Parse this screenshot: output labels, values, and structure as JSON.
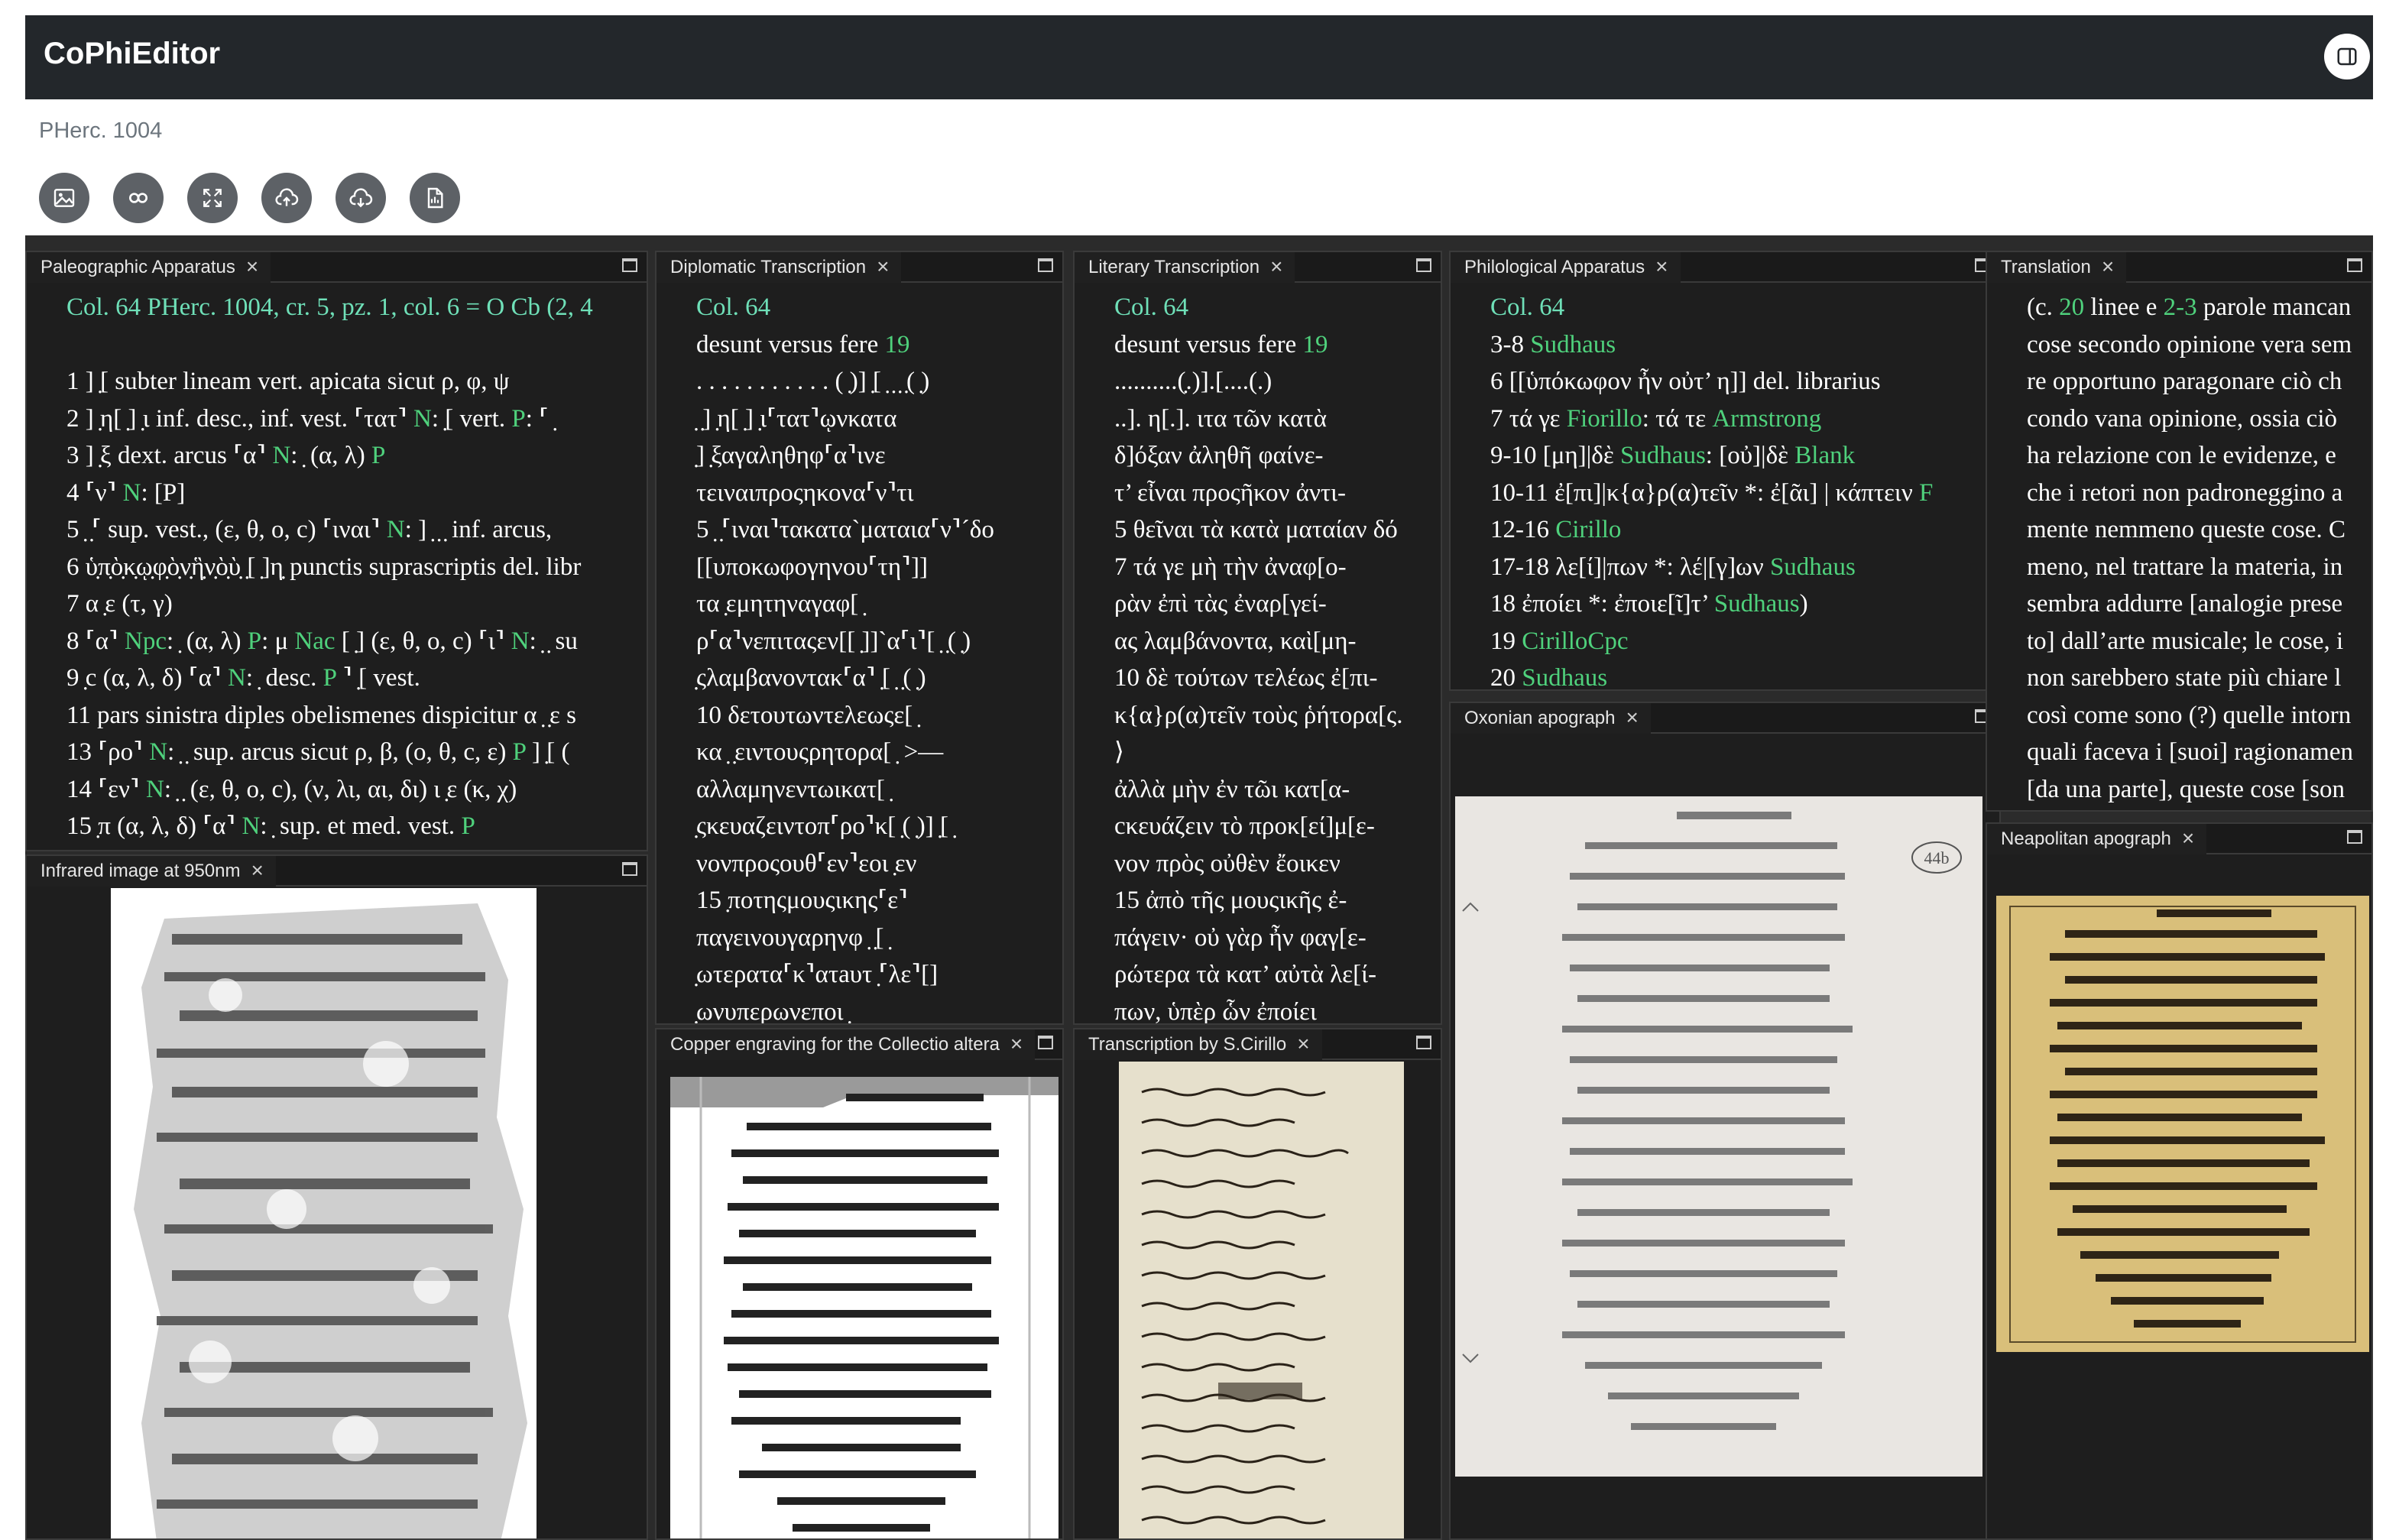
{
  "app": {
    "title": "CoPhiEditor"
  },
  "document": {
    "title": "PHerc. 1004"
  },
  "toolbar": {
    "buttons": [
      {
        "name": "image-icon"
      },
      {
        "name": "link-icon"
      },
      {
        "name": "fullscreen-icon"
      },
      {
        "name": "cloud-upload-icon"
      },
      {
        "name": "cloud-download-icon"
      },
      {
        "name": "document-icon"
      }
    ]
  },
  "colors": {
    "topbar": "#23272b",
    "panel_bg": "#1e1e1e",
    "teal_text": "#6fe0b8",
    "green_text": "#4fd17c"
  },
  "panels": {
    "paleographic": {
      "tab": "Paleographic Apparatus",
      "header": {
        "col": "Col. 64",
        "pherc": "PHerc.",
        "num": "1004, cr.",
        "cr": "5",
        "pz_label": ", pz.",
        "pz": "1",
        "col_label": ", col.",
        "col_num": "6",
        "eq": "=",
        "o": "O",
        "cb": "Cb",
        "rest": "(2, 4"
      },
      "lines": [
        [
          "1 ] ̣[ subter lineam vert. apicata sicut ρ, φ, ψ"
        ],
        [
          "2 ] ̣η[ ̣] ̣ι inf. desc., inf. vest. ⸢τατ⸣ ",
          "N",
          ": ̣[ vert. ",
          "P",
          ": ⸢ ̣"
        ],
        [
          "3 ] ̣ξ dext. arcus ⸢α⸣ ",
          "N",
          ": ̣ (α, λ) ",
          "P",
          ""
        ],
        [
          "4 ⸢ν⸣ ",
          "N",
          ": [P]",
          "",
          ""
        ],
        [
          "5 ̣ ̣⸢ sup. vest., (ε, θ, ο, c) ⸢ιναι⸣ ",
          "N",
          ": ] ̣ ̣ ̣ inf. arcus,",
          "",
          ""
        ],
        [
          "6 ὑ̣π̣ὸ̣κ̣ῳ̣φ̣ὸ̣ν̣ἣ̣ν̣ὸ̣ὺ̣ ̣[ ̣]η̣ punctis suprascriptis del. libr",
          "",
          "",
          "",
          ""
        ],
        [
          "7 α ̣ε (τ, γ)",
          "",
          "",
          "",
          ""
        ],
        [
          "8 ⸢α⸣ ",
          "Npc",
          ": ̣ (α, λ) ",
          "P",
          ": μ ",
          "Nac",
          " [ ̣] (ε, θ, ο, c) ⸢ι⸣ ",
          "N",
          ": ̣ ̣ su"
        ],
        [
          "9 ̣c (α, λ, δ) ⸢α⸣ ",
          "N",
          ": ̣ desc. ",
          "P",
          " ⸣ ̣[ vest."
        ],
        [
          "11 pars sinistra diples obelismenes dispicitur α ̣ ̣ε s",
          "",
          "",
          "",
          ""
        ],
        [
          "13 ⸢ρο⸣ ",
          "N",
          ": ̣ ̣ sup. arcus sicut ρ, β, (ο, θ, c, ε) ",
          "P",
          " ] ̣[ ("
        ],
        [
          "14 ⸢εν⸣ ",
          "N",
          ": ̣ ̣ (ε, θ, ο, c), (ν, λι, αι, δι) ι ̣ε (κ, χ)",
          "",
          ""
        ],
        [
          "15 ̣π (α, λ, δ) ⸢α⸣ ",
          "N",
          ": ̣ sup. et med. vest. ",
          "P",
          ""
        ]
      ]
    },
    "diplomatic": {
      "tab": "Diplomatic Transcription",
      "col": "Col. 64",
      "desunt": "desunt versus fere ",
      "desunt_num": "19",
      "lines": [
        ". . . . . . . . . . . ( ̣)] ̣[ ̣ ̣ ̣ ̣( ̣)",
        " ̣ ̣] ̣η[ ̣] ̣ι⸢τατ⸣ῳνκατα",
        " ̣] ̣ξαγαληθηφ⸢α⸣ινε",
        "τειναιπροςηκονα⸢ν⸣τι",
        "5  ̣ ̣⸢ιναι⸣τακατα`ματαια⸢ν⸣´δο",
        "[[υποκωφογηνου⸢τη⸣]]",
        "τα ̣εμητηναγαφ[ ̣",
        "ρ⸢α⸣νεπιταςεν[[ ̣]]`α⸢ι⸣[ ̣ ̣( ̣)",
        " ̣ςλαμβανοντακ⸢α⸣ ̣[ ̣ ̣( ̣)",
        "10 δετουτωντελεωςε[ ̣",
        "κα ̣ ̣ειντουςρητορα[ ̣ >—",
        "αλλαμηνεντωικατ[ ̣",
        " ̣ςκευαζειντοπ⸢ρο⸣κ[ ̣( ̣)] ̣[ ̣",
        "νονπροςουθ⸢εν⸣εοι ̣εν",
        "15  ̣ποτηςμουςικης⸢ε⸣",
        "παγεινουγαρηνφ ̣ ̣[ ̣",
        " ̣ωτερατα⸢κ⸣ατaυτ ̣⸢λε⸣[]",
        " ̣ωνυπερωνεποι ̣"
      ]
    },
    "literary": {
      "tab": "Literary Transcription",
      "col": "Col. 64",
      "desunt": "desunt versus fere ",
      "desunt_num": "19",
      "lines": [
        "..........(̣.)].[....(.)",
        "..]. η[.]. ιτα τῶν κατὰ",
        "δ]όξαν ἀληθῆ φαίνε-",
        "τ’ εἶναι προςῆκον ἀντι-",
        "5  θεῖναι τὰ κατὰ ματαίαν δό",
        "7  τά γε μὴ τὴν ἀναφ[ο-",
        "ρὰν ἐπὶ τὰς ἐναρ[γεί-",
        "ας λαμβάνοντα, καὶ[μη-",
        "10 δὲ τούτων τελέως ἐ[πι-",
        "κ{α}ρ(α)τεῖν τοὺς ῥήτορα[ς.",
        "⟩",
        "ἀλλὰ μὴν ἐν τῶι κατ[α-",
        "cκευάζειν τὸ προκ[εί]μ[ε-",
        "νον πρὸς οὐθὲν ἔοικεν",
        "15 ἀπὸ τῆς μουςικῆς ἐ-",
        "πάγειν· οὐ γὰρ ἦν φαγ[ε-",
        "ρώτερα τὰ κατ’ αὐτὰ λε[ί-",
        "πων, ὑπὲρ ὧν ἐποίει"
      ]
    },
    "philological": {
      "tab": "Philological Apparatus",
      "col": "Col. 64",
      "entries": [
        {
          "pre": "3-8 ",
          "hl": "Sudhaus",
          "post": ""
        },
        {
          "pre": "6 [[ὑπόκωφον ἦν οὐτ’ η]] del. librarius",
          "hl": "",
          "post": ""
        },
        {
          "pre": "7 τά γε ",
          "hl": "Fiorillo",
          "post": ": τά τε ",
          "hl2": "Armstrong"
        },
        {
          "pre": "9-10 [μη]|δὲ ",
          "hl": "Sudhaus",
          "post": ": [οὐ]|δὲ ",
          "hl2": "Blank"
        },
        {
          "pre": "10-11 ἐ[πι]|κ{α}ρ(α)τεῖν *: ἐ[ᾶι] | κάπτειν ",
          "hl": "F",
          "post": ""
        },
        {
          "pre": "12-16 ",
          "hl": "Cirillo",
          "post": ""
        },
        {
          "pre": "17-18 λε[ί]|πων *: λέ|[γ]ων ",
          "hl": "Sudhaus",
          "post": ""
        },
        {
          "pre": "18 ἐποίει *: ἐποιε[ῖ]τ’ ",
          "hl": "Sudhaus",
          "post": ")"
        },
        {
          "pre": "19 ",
          "hl": "CirilloCpc",
          "post": ""
        },
        {
          "pre": "20 ",
          "hl": "Sudhaus",
          "post": ""
        }
      ]
    },
    "translation": {
      "tab": "Translation",
      "first_pre": "(c. ",
      "first_num": "20",
      "first_mid": " linee e ",
      "first_num2": "2-3",
      "first_post": " parole mancan",
      "lines": [
        "cose secondo opinione vera sem",
        "re opportuno paragonare ciò ch",
        "condo vana opinione, ossia ciò",
        "ha relazione con le evidenze, e",
        "che i retori non padroneggino a",
        "mente nemmeno queste cose. C",
        "meno, nel trattare la materia, in",
        "sembra addurre [analogie prese",
        "to] dall’arte musicale; le cose, i",
        "non sarebbero state più chiare l",
        "così come sono (?) quelle intorn",
        "quali faceva i [suoi] ragionamen",
        "[da una parte], queste cose [son"
      ]
    },
    "infrared": {
      "tab": "Infrared image at 950nm"
    },
    "copper": {
      "tab": "Copper engraving for the Collectio altera"
    },
    "cirillo": {
      "tab": "Transcription by S.Cirillo"
    },
    "oxonian": {
      "tab": "Oxonian apograph",
      "page_number": "44b"
    },
    "neapolitan": {
      "tab": "Neapolitan apograph"
    }
  }
}
